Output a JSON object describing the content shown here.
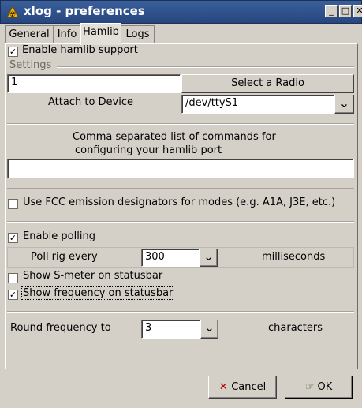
{
  "window": {
    "title": "xlog - preferences"
  },
  "tabs": [
    {
      "label": "General"
    },
    {
      "label": "Info"
    },
    {
      "label": "Hamlib"
    },
    {
      "label": "Logs"
    }
  ],
  "hamlib": {
    "enable_label": "Enable hamlib support",
    "settings_label": "Settings",
    "radio_value": "1",
    "select_radio_label": "Select a Radio",
    "attach_label": "Attach to Device",
    "device_value": "/dev/ttyS1",
    "commands_text_line1": "Comma separated list of commands for",
    "commands_text_line2": "configuring your hamlib port",
    "commands_value": "",
    "fcc_label": "Use FCC emission designators for modes (e.g. A1A, J3E, etc.)",
    "polling_label": "Enable polling",
    "poll_every_label": "Poll rig every",
    "poll_value": "300",
    "milliseconds_label": "milliseconds",
    "smeter_label": "Show S-meter on statusbar",
    "freq_label": "Show frequency on statusbar",
    "round_label": "Round frequency to",
    "round_value": "3",
    "characters_label": "characters"
  },
  "dialog": {
    "cancel_label": "Cancel",
    "ok_label": "OK"
  },
  "icons": {
    "app": "warning-triangle-icon",
    "cancel": "cross-icon",
    "ok": "pointing-hand-icon"
  }
}
